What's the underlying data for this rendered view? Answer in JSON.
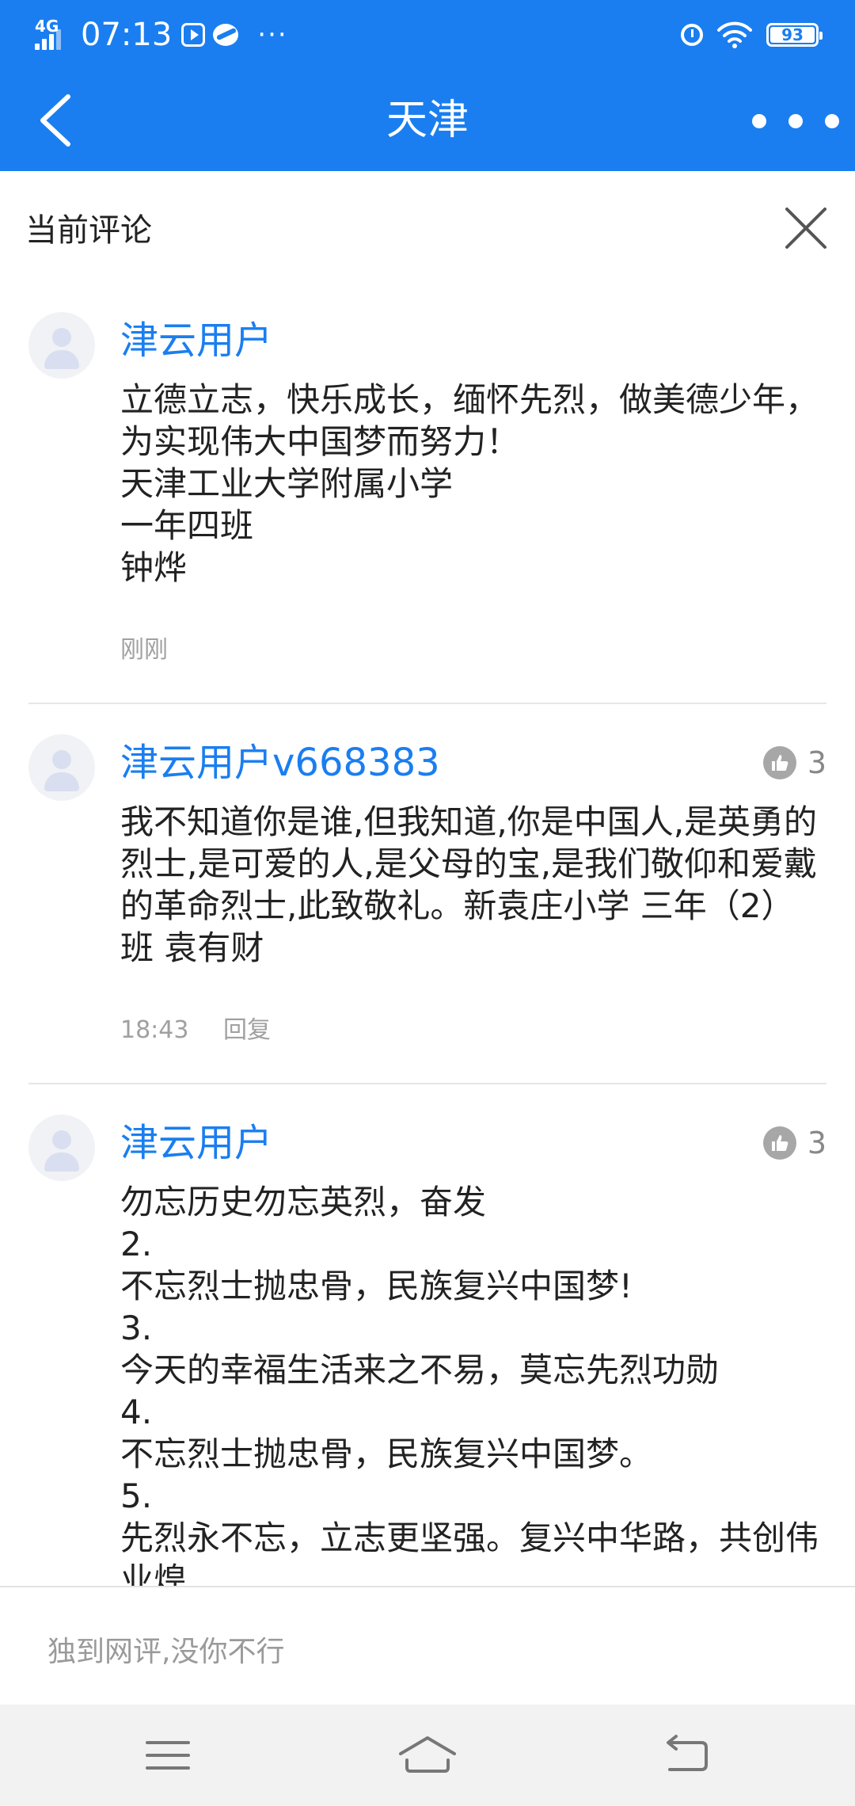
{
  "status_bar": {
    "network": "4G",
    "time": "07:13",
    "overflow": "···",
    "battery": "93",
    "icons": [
      "play-icon",
      "planet-icon",
      "alarm-icon",
      "wifi-icon",
      "battery-icon"
    ]
  },
  "header": {
    "title": "天津",
    "back_icon": "chevron-left-icon",
    "more_icon": "more-dots-icon",
    "bg_color": "#1a7ef0"
  },
  "panel": {
    "title": "当前评论",
    "close_icon": "close-icon"
  },
  "comments": [
    {
      "user": "津云用户",
      "text": "立德立志，快乐成长，缅怀先烈，做美德少年，为实现伟大中国梦而努力！\n天津工业大学附属小学\n一年四班\n钟烨",
      "time": "刚刚",
      "likes": "",
      "reply": ""
    },
    {
      "user": "津云用户v668383",
      "text": "我不知道你是谁,但我知道,你是中国人,是英勇的烈士,是可爱的人,是父母的宝,是我们敬仰和爱戴的革命烈士,此致敬礼。新袁庄小学 三年（2）班 袁有财",
      "time": "18:43",
      "likes": "3",
      "reply": "回复"
    },
    {
      "user": "津云用户",
      "text": "勿忘历史勿忘英烈，奋发\n2.\n不忘烈士抛忠骨，民族复兴中国梦!\n3.\n今天的幸福生活来之不易，莫忘先烈功勋\n4.\n不忘烈士抛忠骨，民族复兴中国梦。\n5.\n先烈永不忘，立志更坚强。复兴中华路，共创伟业煌",
      "time": "",
      "likes": "3",
      "reply": ""
    }
  ],
  "input": {
    "placeholder": "独到网评,没你不行"
  },
  "nav": {
    "items": [
      "menu-icon",
      "home-icon",
      "back-icon"
    ]
  }
}
